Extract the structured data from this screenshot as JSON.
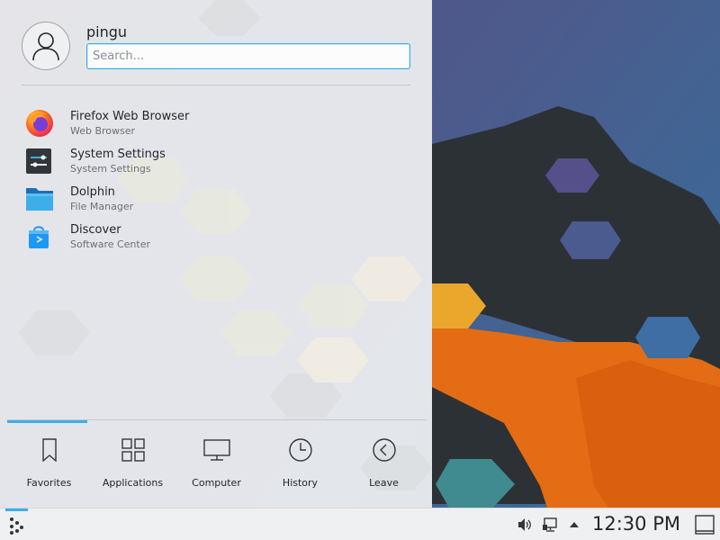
{
  "user": {
    "name": "pingu",
    "avatar_icon": "user-avatar-icon"
  },
  "search": {
    "placeholder": "Search...",
    "value": ""
  },
  "favorites": [
    {
      "name": "Firefox Web Browser",
      "description": "Web Browser",
      "icon": "firefox-icon"
    },
    {
      "name": "System Settings",
      "description": "System Settings",
      "icon": "system-settings-icon"
    },
    {
      "name": "Dolphin",
      "description": "File Manager",
      "icon": "dolphin-folder-icon"
    },
    {
      "name": "Discover",
      "description": "Software Center",
      "icon": "discover-icon"
    }
  ],
  "tabs": [
    {
      "label": "Favorites",
      "icon": "bookmark-icon",
      "active": true
    },
    {
      "label": "Applications",
      "icon": "grid-icon",
      "active": false
    },
    {
      "label": "Computer",
      "icon": "monitor-icon",
      "active": false
    },
    {
      "label": "History",
      "icon": "clock-icon",
      "active": false
    },
    {
      "label": "Leave",
      "icon": "back-arrow-icon",
      "active": false
    }
  ],
  "panel": {
    "clock": "12:30 PM",
    "tray_icons": [
      "volume-icon",
      "network-icon",
      "expand-tray-icon"
    ],
    "show_desktop_icon": "show-desktop-icon",
    "launcher_icon": "kickoff-launcher-icon"
  },
  "colors": {
    "accent": "#3daee9",
    "wallpaper_purple": "#574f82",
    "wallpaper_dark": "#2c3136",
    "wallpaper_orange": "#e9731d",
    "wallpaper_yellow": "#eba72b",
    "wallpaper_teal": "#3f8b8f",
    "wallpaper_blue": "#3a5f8e"
  }
}
